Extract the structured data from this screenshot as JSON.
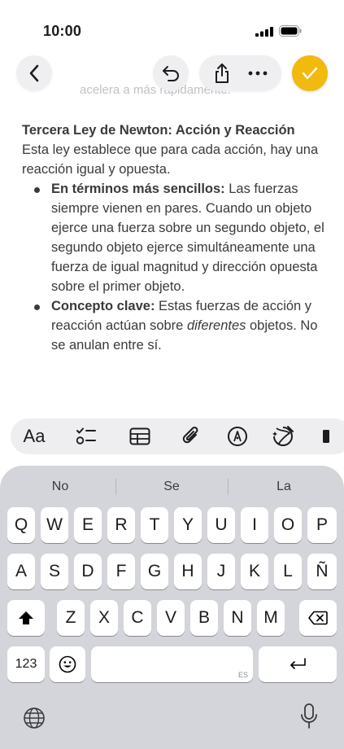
{
  "status": {
    "time": "10:00"
  },
  "toolbar": {
    "done_color": "#f2b90f"
  },
  "note": {
    "ghost_line": "acelera a más rápidamente.",
    "heading": "Tercera Ley de Newton: Acción y Reacción",
    "intro": "Esta ley establece que para cada acción, hay una reacción igual y opuesta.",
    "bullets": [
      {
        "bold": "En términos más sencillos:",
        "text": " Las fuerzas siempre vienen en pares. Cuando un objeto ejerce una fuerza sobre un segundo objeto, el segundo objeto ejerce simultáneamente una fuerza de igual magnitud y dirección opuesta sobre el primer objeto."
      },
      {
        "bold": "Concepto clave:",
        "text_before": " Estas fuerzas de acción y reacción actúan sobre ",
        "italic": "diferentes",
        "text_after": " objetos. No se anulan entre sí."
      }
    ]
  },
  "format_bar": {
    "aa": "Aa",
    "icons": [
      "checklist-icon",
      "table-icon",
      "attachment-icon",
      "markup-pen-icon",
      "writing-tools-icon",
      "more-icon"
    ]
  },
  "keyboard": {
    "suggestions": [
      "No",
      "Se",
      "La"
    ],
    "row1": [
      "Q",
      "W",
      "E",
      "R",
      "T",
      "Y",
      "U",
      "I",
      "O",
      "P"
    ],
    "row2": [
      "A",
      "S",
      "D",
      "F",
      "G",
      "H",
      "J",
      "K",
      "L",
      "Ñ"
    ],
    "row3": [
      "Z",
      "X",
      "C",
      "V",
      "B",
      "N",
      "M"
    ],
    "numbers_label": "123",
    "space_lang": "ES"
  }
}
